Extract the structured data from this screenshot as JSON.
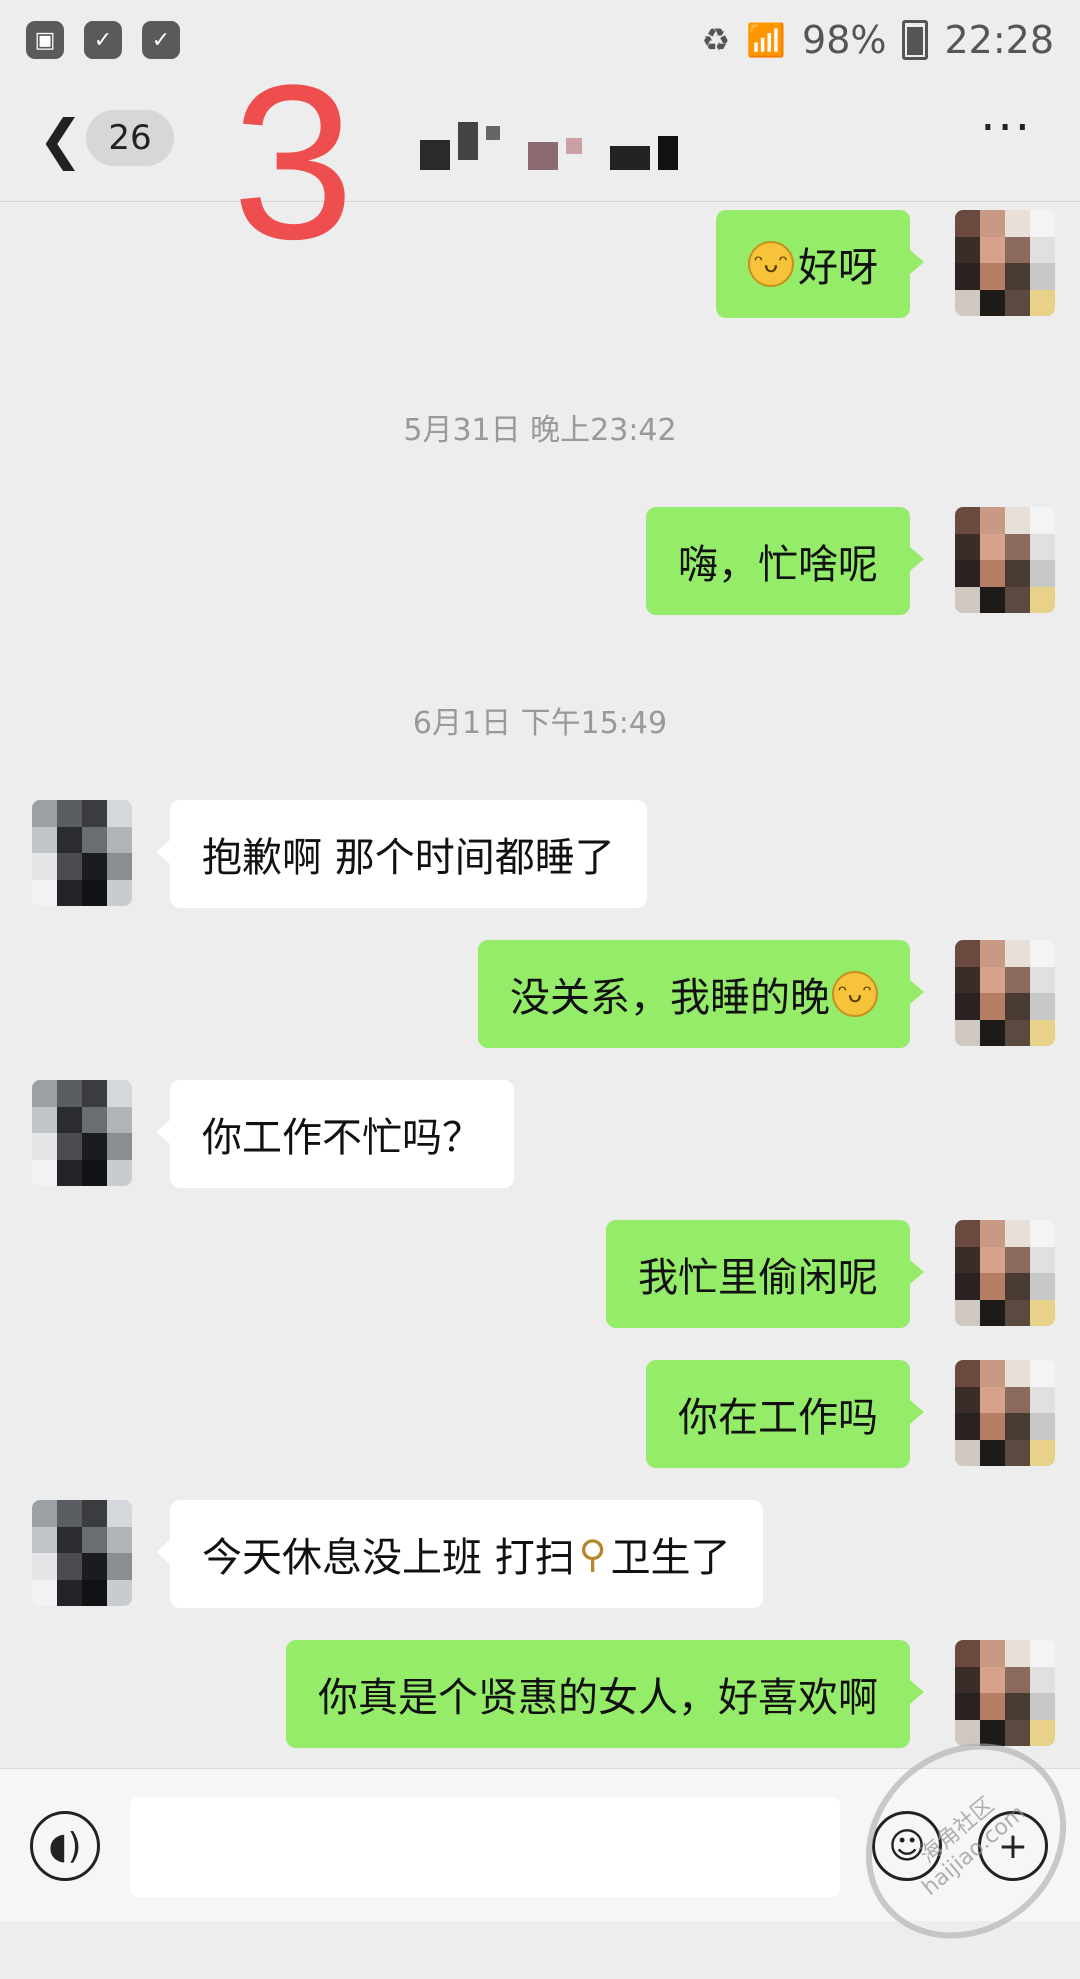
{
  "status_bar": {
    "battery": "98%",
    "time": "22:28"
  },
  "header": {
    "back_icon": "chevron-left-icon",
    "unread_count": "26",
    "overlay_number": "3",
    "more_label": "···"
  },
  "messages": [
    {
      "side": "me",
      "text": "好呀",
      "emoji_before": true
    },
    {
      "type": "time",
      "text": "5月31日 晚上23:42"
    },
    {
      "side": "me",
      "text": "嗨，忙啥呢"
    },
    {
      "type": "time",
      "text": "6月1日 下午15:49"
    },
    {
      "side": "her",
      "text": "抱歉啊 那个时间都睡了"
    },
    {
      "side": "me",
      "text": "没关系，我睡的晚"
    },
    {
      "side": "her",
      "text": "你工作不忙吗？"
    },
    {
      "side": "me",
      "text": "我忙里偷闲呢"
    },
    {
      "side": "me",
      "text": "你在工作吗"
    },
    {
      "side": "her",
      "text_a": "今天休息没上班 打扫",
      "text_b": "卫生了"
    },
    {
      "side": "me",
      "text": "你真是个贤惠的女人，好喜欢啊"
    }
  ],
  "input_bar": {
    "voice_icon": "voice-icon",
    "emoji_icon": "smiley-icon",
    "plus_icon": "plus-icon",
    "value": ""
  },
  "watermark": {
    "line1": "海角社区",
    "line2": "haijiao.com"
  },
  "colors": {
    "background": "#ededed",
    "my_bubble": "#95ec69",
    "her_bubble": "#ffffff",
    "overlay_number": "#ef4e4e"
  }
}
